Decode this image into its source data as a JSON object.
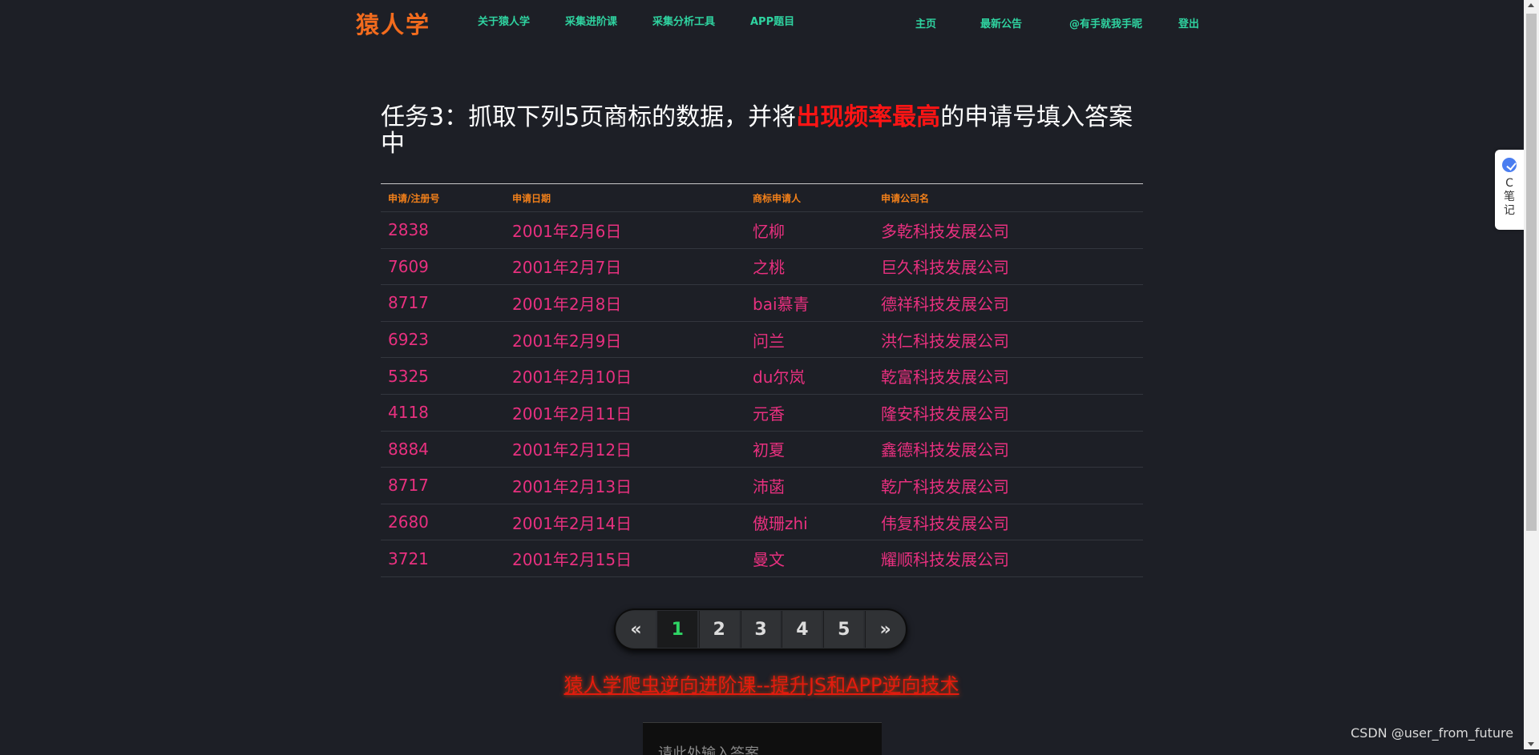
{
  "nav": {
    "logo": "猿人学",
    "left_items": [
      "关于猿人学",
      "采集进阶课",
      "采集分析工具",
      "APP题目"
    ],
    "right_items": [
      "主页",
      "最新公告",
      "@有手就我手昵",
      "登出"
    ]
  },
  "task": {
    "prefix": "任务3：抓取下列5页商标的数据，并将",
    "highlight": "出现频率最高",
    "suffix": "的申请号填入答案中"
  },
  "table": {
    "headers": [
      "申请/注册号",
      "申请日期",
      "商标申请人",
      "申请公司名"
    ],
    "rows": [
      [
        "2838",
        "2001年2月6日",
        "忆柳",
        "多乾科技发展公司"
      ],
      [
        "7609",
        "2001年2月7日",
        "之桃",
        "巨久科技发展公司"
      ],
      [
        "8717",
        "2001年2月8日",
        "bai慕青",
        "德祥科技发展公司"
      ],
      [
        "6923",
        "2001年2月9日",
        "问兰",
        "洪仁科技发展公司"
      ],
      [
        "5325",
        "2001年2月10日",
        "du尔岚",
        "乾富科技发展公司"
      ],
      [
        "4118",
        "2001年2月11日",
        "元香",
        "隆安科技发展公司"
      ],
      [
        "8884",
        "2001年2月12日",
        "初夏",
        "鑫德科技发展公司"
      ],
      [
        "8717",
        "2001年2月13日",
        "沛菡",
        "乾广科技发展公司"
      ],
      [
        "2680",
        "2001年2月14日",
        "傲珊zhi",
        "伟复科技发展公司"
      ],
      [
        "3721",
        "2001年2月15日",
        "曼文",
        "耀顺科技发展公司"
      ]
    ]
  },
  "pagination": {
    "prev": "«",
    "pages": [
      "1",
      "2",
      "3",
      "4",
      "5"
    ],
    "next": "»",
    "active": "1"
  },
  "promo": "猿人学爬虫逆向进阶课--提升JS和APP逆向技术",
  "answer_placeholder": "请此处输入答案",
  "side_note": {
    "label1": "C",
    "label2": "笔",
    "label3": "记",
    "icon": "note-check-icon"
  },
  "watermark": "CSDN @user_from_future",
  "colors": {
    "background": "#1d1f26",
    "logo": "#f26b1d",
    "nav": "#2fd3a0",
    "highlight": "#ff1414",
    "table_header": "#f2801a",
    "table_cell": "#e8307f",
    "active_page": "#2fd565",
    "promo": "#e41b0e"
  }
}
